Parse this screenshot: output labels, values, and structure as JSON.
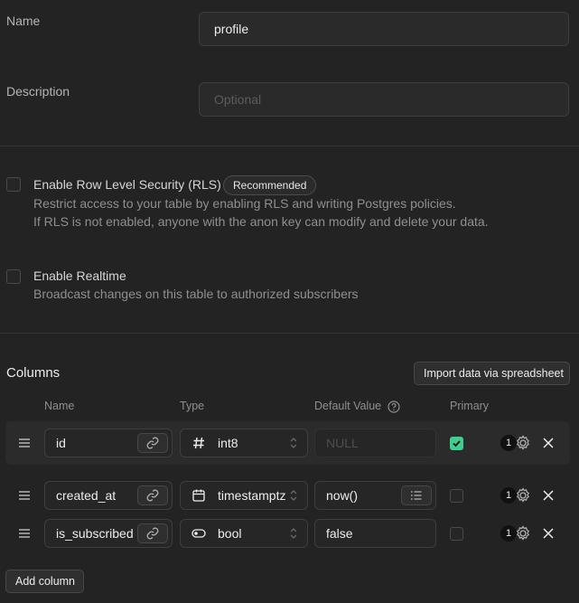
{
  "form": {
    "name_label": "Name",
    "name_value": "profile",
    "description_label": "Description",
    "description_placeholder": "Optional"
  },
  "rls": {
    "title": "Enable Row Level Security (RLS)",
    "badge": "Recommended",
    "desc1": "Restrict access to your table by enabling RLS and writing Postgres policies.",
    "desc2": "If RLS is not enabled, anyone with the anon key can modify and delete your data."
  },
  "realtime": {
    "title": "Enable Realtime",
    "desc": "Broadcast changes on this table to authorized subscribers"
  },
  "columns": {
    "title": "Columns",
    "import_button": "Import data via spreadsheet",
    "headers": {
      "name": "Name",
      "type": "Type",
      "default": "Default Value",
      "primary": "Primary"
    },
    "default_placeholder": "NULL",
    "rows": [
      {
        "name": "id",
        "type": "int8",
        "type_icon": "hash-icon",
        "default": "",
        "primary": true,
        "badge": "1"
      },
      {
        "name": "created_at",
        "type": "timestamptz",
        "type_icon": "calendar-icon",
        "default": "now()",
        "primary": false,
        "badge": "1"
      },
      {
        "name": "is_subscribed",
        "type": "bool",
        "type_icon": "toggle-icon",
        "default": "false",
        "primary": false,
        "badge": "1"
      }
    ],
    "add_button": "Add column"
  },
  "colors": {
    "accent": "#3ecf8e",
    "background": "#232323"
  }
}
